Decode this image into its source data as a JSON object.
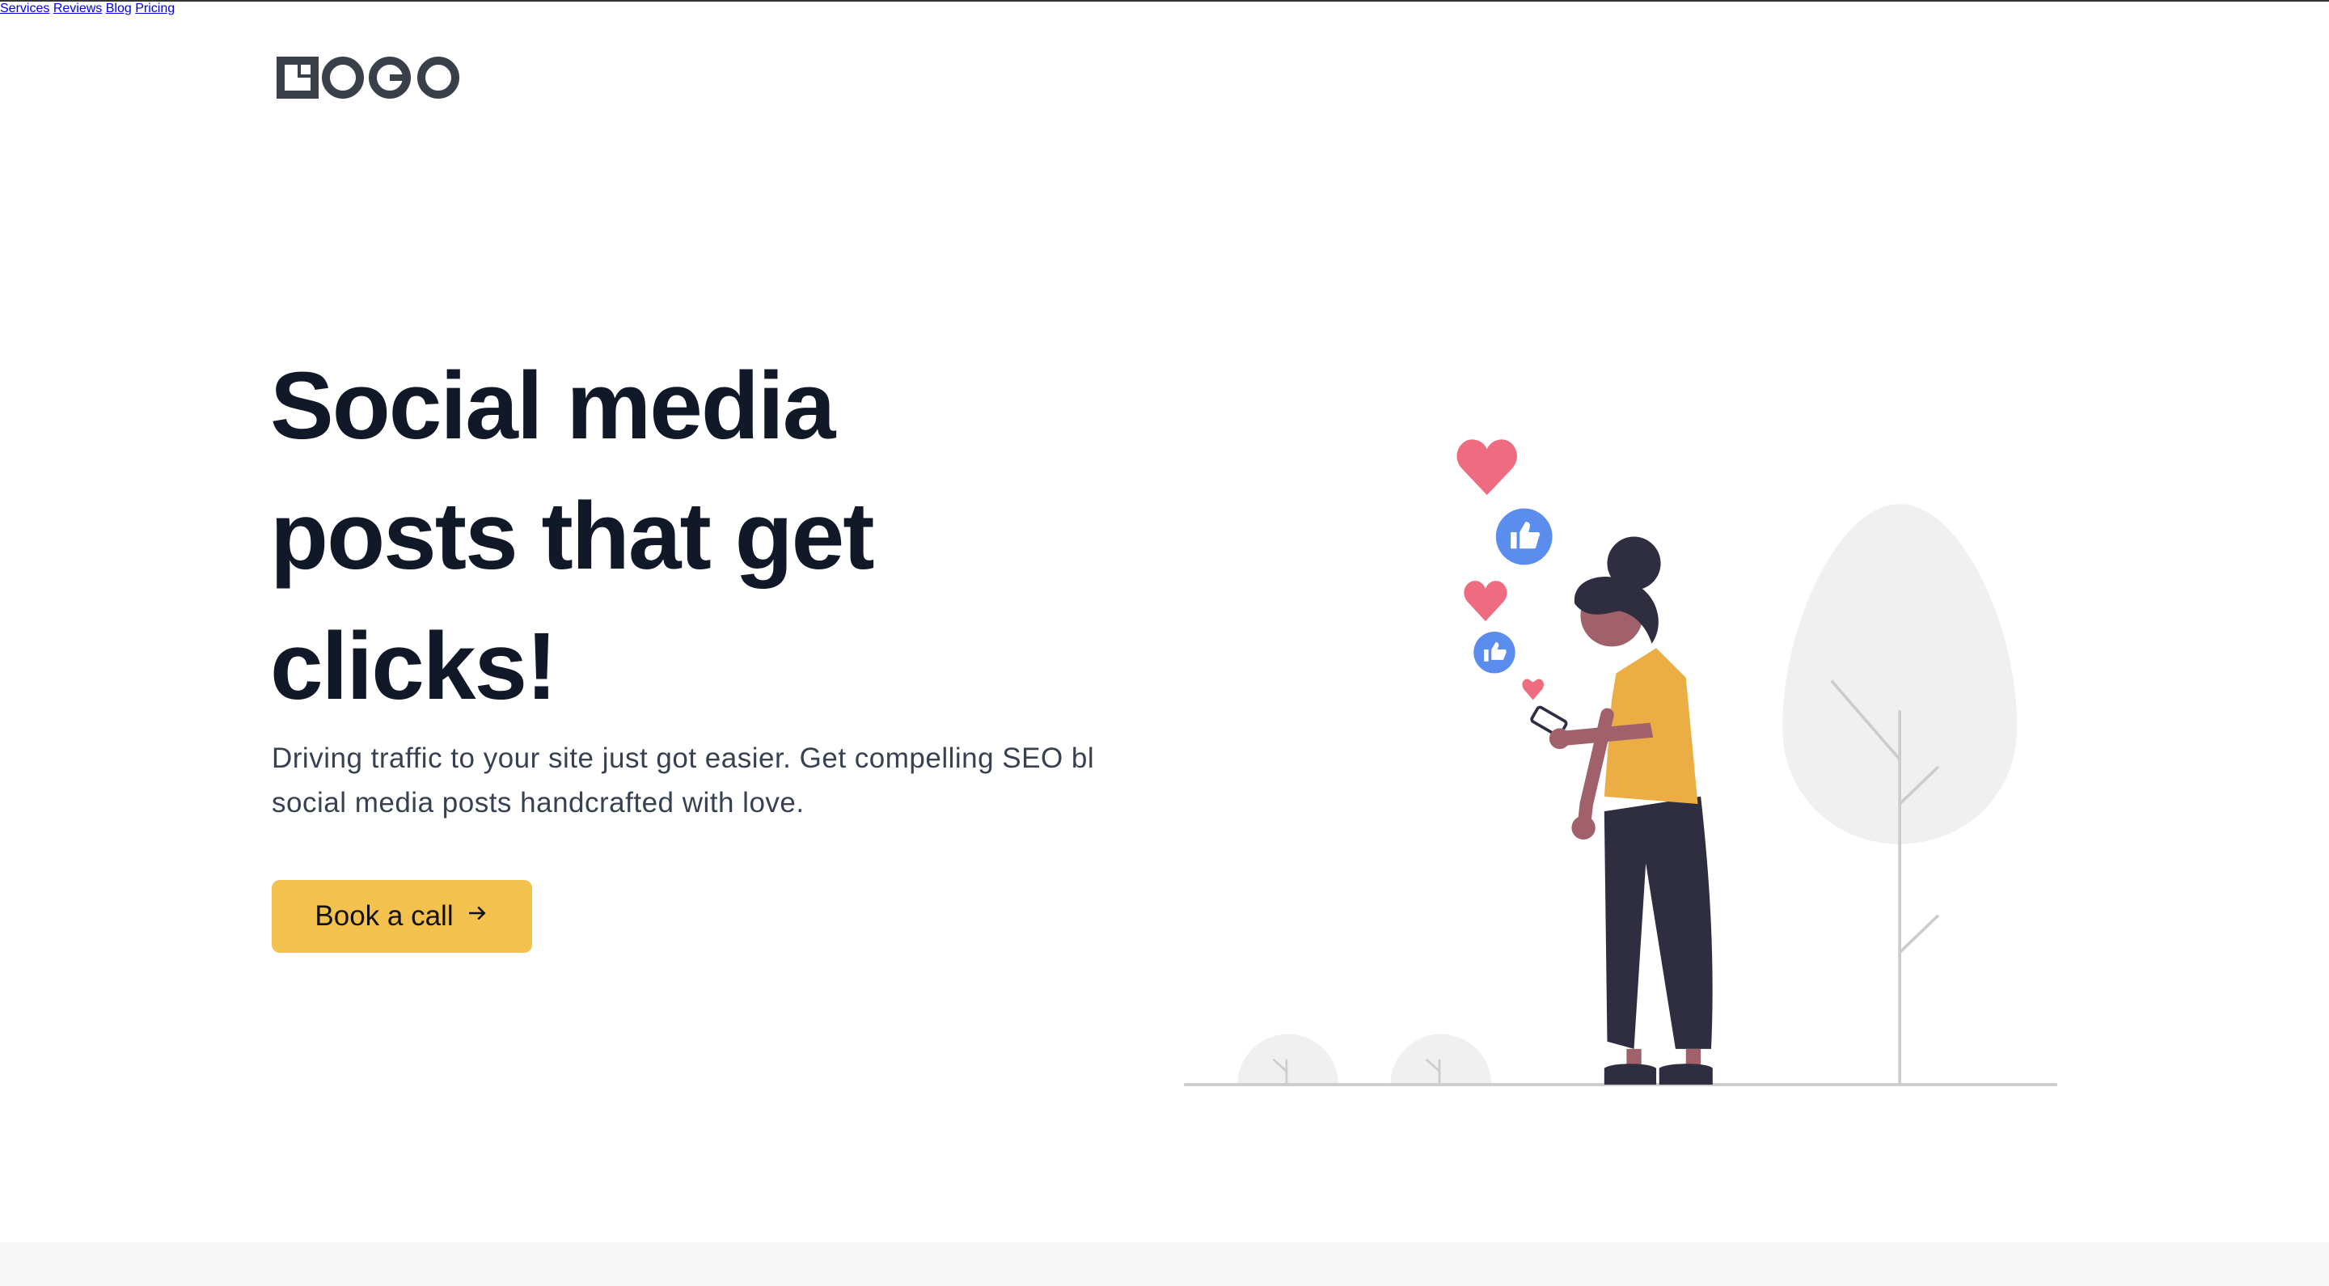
{
  "header": {
    "logo_text": "LOGO",
    "nav": [
      {
        "label": "Services"
      },
      {
        "label": "Reviews"
      },
      {
        "label": "Blog"
      },
      {
        "label": "Pricing"
      }
    ]
  },
  "hero": {
    "headline_lines": [
      "Social media",
      "posts that get",
      "clicks!"
    ],
    "subtitle_lines": [
      "Driving traffic to your site just got easier. Get compelling SEO bl",
      "social media posts handcrafted with love."
    ],
    "cta_label": "Book a call",
    "cta_icon": "arrow-right-icon"
  },
  "colors": {
    "accent": "#f2c14e",
    "heading": "#111827",
    "heart": "#ef6b7f",
    "like": "#5b8def",
    "shirt": "#ecad45",
    "dark": "#2f2e41",
    "skin": "#a0616a"
  }
}
